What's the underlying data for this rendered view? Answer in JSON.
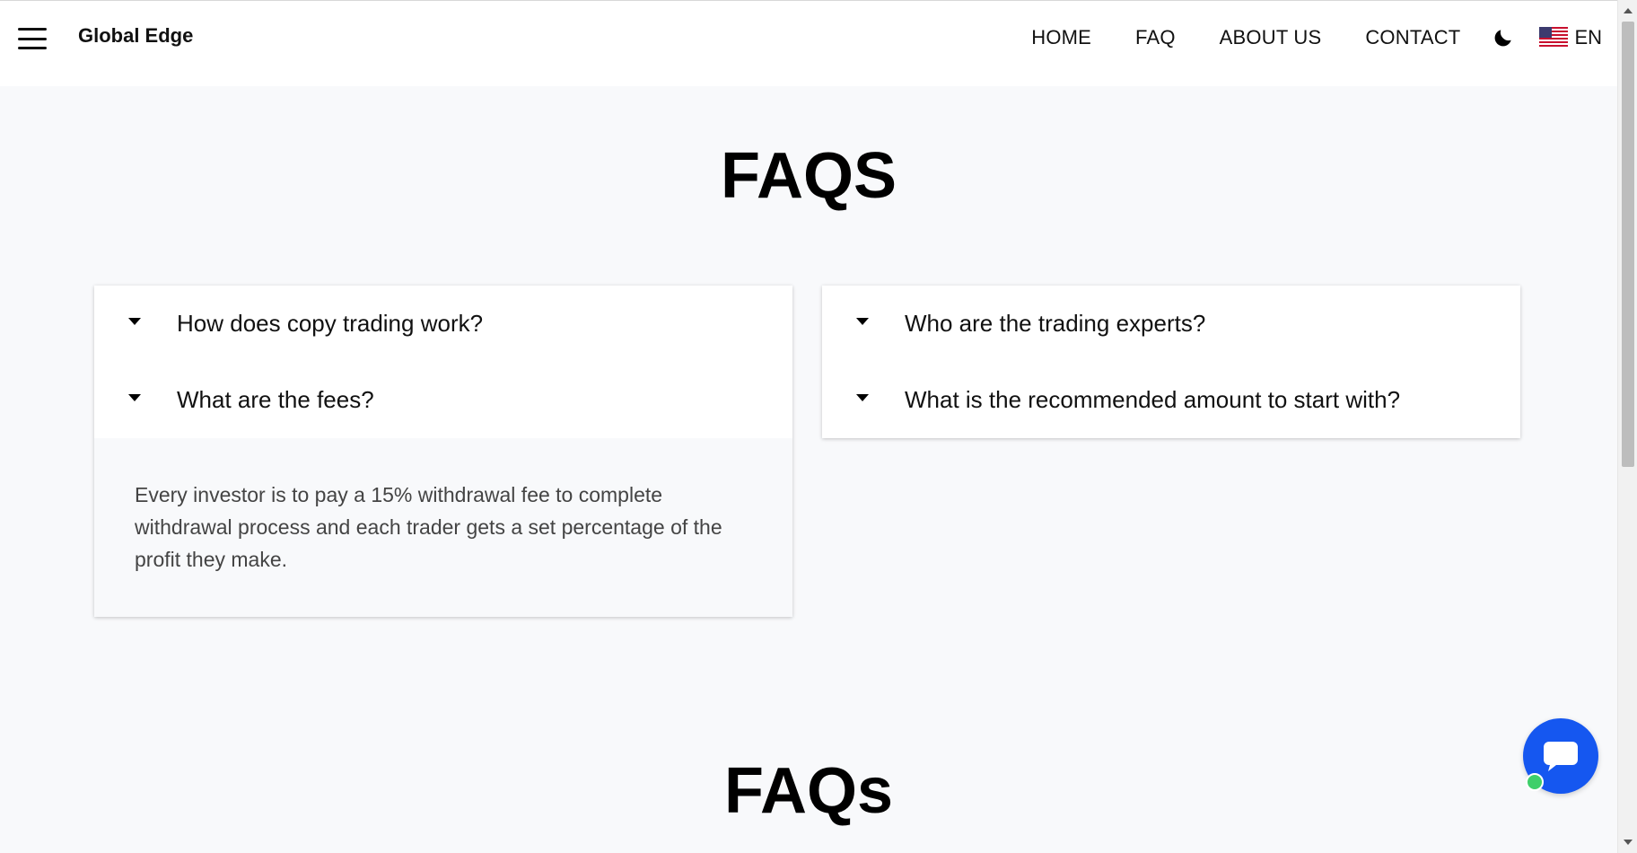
{
  "header": {
    "brand": "Global Edge",
    "nav": [
      "HOME",
      "FAQ",
      "ABOUT US",
      "CONTACT"
    ],
    "language": "EN"
  },
  "main": {
    "title": "FAQS",
    "title_bottom": "FAQs",
    "faq_left": [
      {
        "question": "How does copy trading work?"
      },
      {
        "question": "What are the fees?",
        "answer": "Every investor is to pay a 15% withdrawal fee to complete withdrawal process and each trader gets a set percentage of the profit they make."
      }
    ],
    "faq_right": [
      {
        "question": "Who are the trading experts?"
      },
      {
        "question": "What is the recommended amount to start with?"
      }
    ]
  },
  "colors": {
    "accent": "#1557f0",
    "online": "#3ecf6a",
    "background": "#f8f9fb"
  },
  "icons": [
    "menu-icon",
    "moon-icon",
    "us-flag-icon",
    "chevron-down-icon",
    "chat-icon"
  ]
}
